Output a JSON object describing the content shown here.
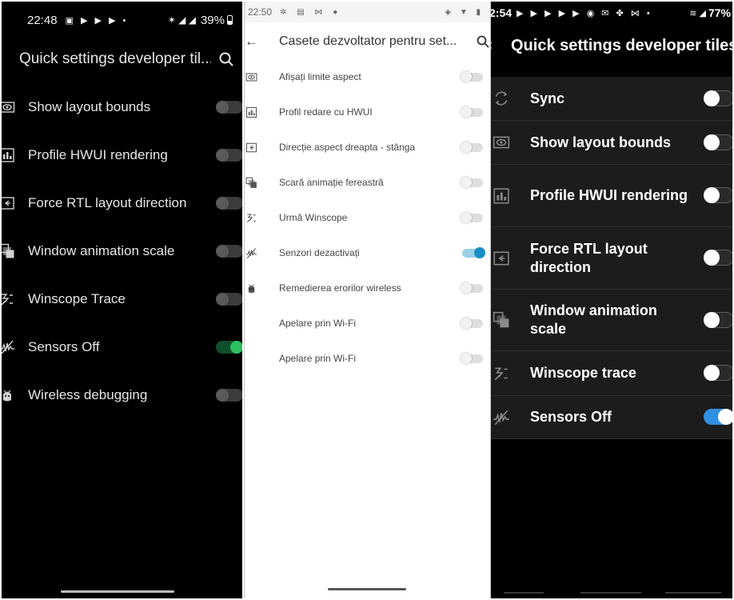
{
  "colors": {
    "p1_bg": "#000000",
    "p1_toggle_on": "#2fbf5f",
    "p2_bg": "#ffffff",
    "p2_toggle_on": "#1a8fc7",
    "p3_bg": "#000000",
    "p3_list_bg": "#1c1c1c",
    "p3_toggle_on": "#2f8fe0"
  },
  "panel1": {
    "status": {
      "time": "22:48",
      "battery": "39%"
    },
    "header": {
      "title": "Quick settings developer til...",
      "back_icon": "back-arrow-icon",
      "search_icon": "search-icon"
    },
    "tiles": [
      {
        "label": "Show layout bounds",
        "icon": "layout-bounds-icon",
        "on": false
      },
      {
        "label": "Profile HWUI rendering",
        "icon": "hwui-profile-icon",
        "on": false
      },
      {
        "label": "Force RTL layout direction",
        "icon": "rtl-direction-icon",
        "on": false
      },
      {
        "label": "Window animation scale",
        "icon": "window-animation-icon",
        "on": false
      },
      {
        "label": "Winscope Trace",
        "icon": "winscope-trace-icon",
        "on": false
      },
      {
        "label": "Sensors Off",
        "icon": "sensors-off-icon",
        "on": true
      },
      {
        "label": "Wireless debugging",
        "icon": "wireless-debugging-icon",
        "on": false
      }
    ]
  },
  "panel2": {
    "status": {
      "time": "22:50"
    },
    "header": {
      "title": "Casete dezvoltator pentru set...",
      "back_icon": "back-arrow-icon",
      "search_icon": "search-icon"
    },
    "tiles": [
      {
        "label": "Afișați limite aspect",
        "icon": "layout-bounds-icon",
        "on": false
      },
      {
        "label": "Profil redare cu HWUI",
        "icon": "hwui-profile-icon",
        "on": false
      },
      {
        "label": "Direcție aspect dreapta - stânga",
        "icon": "rtl-direction-icon",
        "on": false
      },
      {
        "label": "Scară animație fereastră",
        "icon": "window-animation-icon",
        "on": false
      },
      {
        "label": "Urmă Winscope",
        "icon": "winscope-trace-icon",
        "on": false
      },
      {
        "label": "Senzori dezactivați",
        "icon": "sensors-off-icon",
        "on": true
      },
      {
        "label": "Remedierea erorilor wireless",
        "icon": "wireless-debugging-icon",
        "on": false
      },
      {
        "label": "Apelare prin Wi-Fi",
        "icon": "",
        "on": false
      },
      {
        "label": "Apelare prin Wi-Fi",
        "icon": "",
        "on": false
      }
    ]
  },
  "panel3": {
    "status": {
      "time": "2:54",
      "battery": "77%"
    },
    "header": {
      "title": "Quick settings developer tiles",
      "back_icon": "back-arrow-icon"
    },
    "tiles": [
      {
        "label": "Sync",
        "icon": "sync-icon",
        "on": false
      },
      {
        "label": "Show layout bounds",
        "icon": "layout-bounds-icon",
        "on": false
      },
      {
        "label": "Profile HWUI rendering",
        "icon": "hwui-profile-icon",
        "on": false
      },
      {
        "label": "Force RTL layout direction",
        "icon": "rtl-direction-icon",
        "on": false
      },
      {
        "label": "Window animation scale",
        "icon": "window-animation-icon",
        "on": false
      },
      {
        "label": "Winscope trace",
        "icon": "winscope-trace-icon",
        "on": false
      },
      {
        "label": "Sensors Off",
        "icon": "sensors-off-icon",
        "on": true
      }
    ]
  }
}
